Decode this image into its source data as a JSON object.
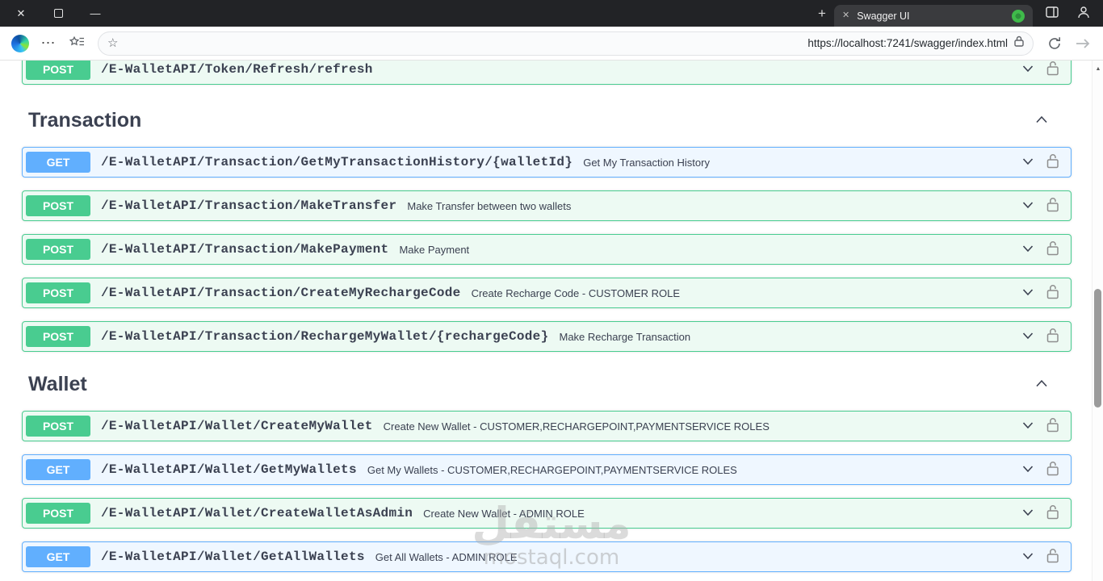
{
  "browser": {
    "icons": {
      "close": "✕",
      "minimize": "—",
      "new_tab": "+",
      "more": "⋯",
      "star": "☆",
      "scroll_up": "▲"
    },
    "tab": {
      "title": "Swagger UI"
    },
    "address": {
      "url": "https://localhost:7241/swagger/index.html"
    }
  },
  "page": {
    "top_partial": {
      "method": "POST",
      "path": "/E-WalletAPI/Token/Refresh/refresh"
    },
    "sections": [
      {
        "title": "Transaction",
        "endpoints": [
          {
            "method": "GET",
            "path": "/E-WalletAPI/Transaction/GetMyTransactionHistory/{walletId}",
            "description": "Get My Transaction History"
          },
          {
            "method": "POST",
            "path": "/E-WalletAPI/Transaction/MakeTransfer",
            "description": "Make Transfer between two wallets"
          },
          {
            "method": "POST",
            "path": "/E-WalletAPI/Transaction/MakePayment",
            "description": "Make Payment"
          },
          {
            "method": "POST",
            "path": "/E-WalletAPI/Transaction/CreateMyRechargeCode",
            "description": "Create Recharge Code - CUSTOMER ROLE"
          },
          {
            "method": "POST",
            "path": "/E-WalletAPI/Transaction/RechargeMyWallet/{rechargeCode}",
            "description": "Make Recharge Transaction"
          }
        ]
      },
      {
        "title": "Wallet",
        "endpoints": [
          {
            "method": "POST",
            "path": "/E-WalletAPI/Wallet/CreateMyWallet",
            "description": "Create New Wallet - CUSTOMER,RECHARGEPOINT,PAYMENTSERVICE ROLES"
          },
          {
            "method": "GET",
            "path": "/E-WalletAPI/Wallet/GetMyWallets",
            "description": "Get My Wallets - CUSTOMER,RECHARGEPOINT,PAYMENTSERVICE ROLES"
          },
          {
            "method": "POST",
            "path": "/E-WalletAPI/Wallet/CreateWalletAsAdmin",
            "description": "Create New Wallet - ADMIN ROLE"
          },
          {
            "method": "GET",
            "path": "/E-WalletAPI/Wallet/GetAllWallets",
            "description": "Get All Wallets - ADMIN ROLE"
          }
        ]
      }
    ],
    "watermark": {
      "arabic": "مستقل",
      "domain": "mostaql.com"
    },
    "colors": {
      "get": "#61affe",
      "post": "#49cc90",
      "text": "#3b4151"
    }
  }
}
